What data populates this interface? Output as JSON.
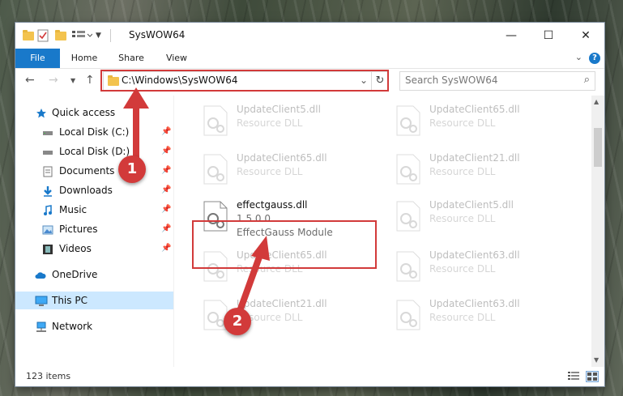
{
  "window": {
    "title": "SysWOW64"
  },
  "ribbon": {
    "tabs": [
      "File",
      "Home",
      "Share",
      "View"
    ]
  },
  "address": {
    "path": "C:\\Windows\\SysWOW64"
  },
  "search": {
    "placeholder": "Search SysWOW64"
  },
  "sidebar": {
    "items": [
      {
        "label": "Quick access",
        "icon": "star-icon"
      },
      {
        "label": "Local Disk (C:)",
        "icon": "drive-icon"
      },
      {
        "label": "Local Disk (D:)",
        "icon": "drive-icon"
      },
      {
        "label": "Documents",
        "icon": "documents-icon"
      },
      {
        "label": "Downloads",
        "icon": "download-icon"
      },
      {
        "label": "Music",
        "icon": "music-icon"
      },
      {
        "label": "Pictures",
        "icon": "pictures-icon"
      },
      {
        "label": "Videos",
        "icon": "videos-icon"
      },
      {
        "label": "OneDrive",
        "icon": "cloud-icon"
      },
      {
        "label": "This PC",
        "icon": "computer-icon"
      },
      {
        "label": "Network",
        "icon": "network-icon"
      }
    ]
  },
  "files": [
    {
      "name": "UpdateClient5.dll",
      "type": "Resource DLL"
    },
    {
      "name": "UpdateClient65.dll",
      "type": "Resource DLL"
    },
    {
      "name": "UpdateClient65.dll",
      "type": "Resource DLL"
    },
    {
      "name": "UpdateClient21.dll",
      "type": "Resource DLL"
    },
    {
      "name": "effectgauss.dll",
      "version": "1.5.0.0",
      "type": "EffectGauss Module"
    },
    {
      "name": "UpdateClient5.dll",
      "type": "Resource DLL"
    },
    {
      "name": "UpdateClient65.dll",
      "type": "Resource DLL"
    },
    {
      "name": "UpdateClient63.dll",
      "type": "Resource DLL"
    },
    {
      "name": "UpdateClient21.dll",
      "type": "Resource DLL"
    },
    {
      "name": "UpdateClient63.dll",
      "type": "Resource DLL"
    }
  ],
  "status": {
    "item_count": "123 items"
  },
  "annotations": {
    "step1": "1",
    "step2": "2"
  },
  "colors": {
    "accent": "#1979ca",
    "highlight": "#d23a3a",
    "selected": "#cce8ff"
  }
}
